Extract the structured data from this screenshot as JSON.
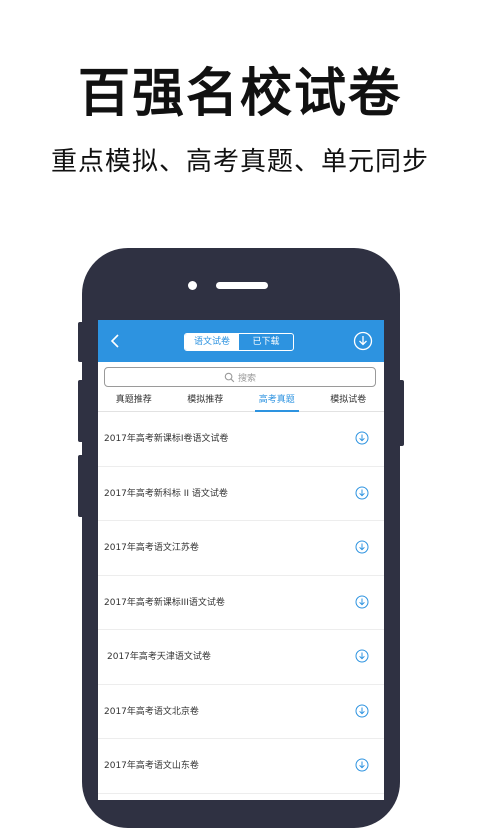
{
  "promo": {
    "headline": "百强名校试卷",
    "subheadline": "重点模拟、高考真题、单元同步"
  },
  "app": {
    "nav": {
      "segments": [
        "语文试卷",
        "已下载"
      ],
      "active_segment": "语文试卷"
    },
    "search": {
      "placeholder": "搜索"
    },
    "tabs": [
      "真题推荐",
      "模拟推荐",
      "高考真题",
      "模拟试卷"
    ],
    "active_tab": "高考真题",
    "papers": [
      "2017年高考新课标I卷语文试卷",
      "2017年高考新科标 II 语文试卷",
      "2017年高考语文江苏卷",
      "2017年高考新课标III语文试卷",
      "2017年高考天津语文试卷",
      "2017年高考语文北京卷",
      "2017年高考语文山东卷"
    ],
    "colors": {
      "primary": "#2d93e0",
      "phone_body": "#2f3142"
    },
    "icons": [
      "back-icon",
      "download-icon",
      "search-icon",
      "download-circle-icon"
    ]
  }
}
